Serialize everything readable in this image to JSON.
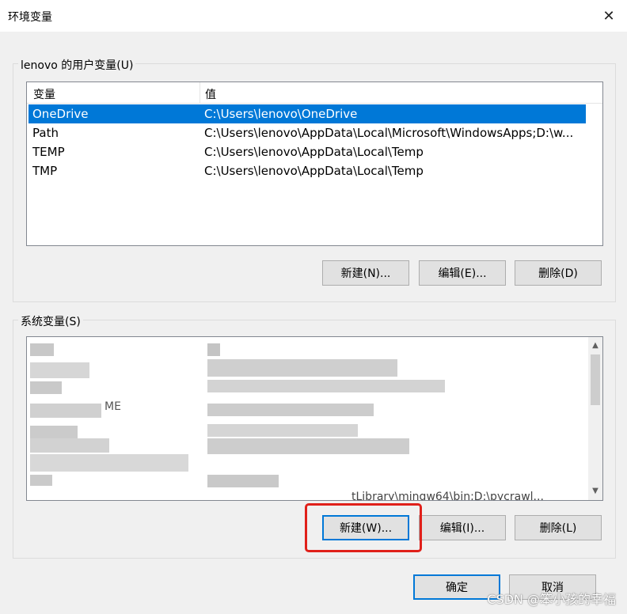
{
  "window": {
    "title": "环境变量",
    "close_symbol": "✕"
  },
  "user_vars": {
    "group_label": "lenovo 的用户变量(U)",
    "columns": [
      "变量",
      "值"
    ],
    "rows": [
      {
        "name": "OneDrive",
        "value": "C:\\Users\\lenovo\\OneDrive",
        "selected": true
      },
      {
        "name": "Path",
        "value": "C:\\Users\\lenovo\\AppData\\Local\\Microsoft\\WindowsApps;D:\\w...",
        "selected": false
      },
      {
        "name": "TEMP",
        "value": "C:\\Users\\lenovo\\AppData\\Local\\Temp",
        "selected": false
      },
      {
        "name": "TMP",
        "value": "C:\\Users\\lenovo\\AppData\\Local\\Temp",
        "selected": false
      }
    ],
    "buttons": {
      "new": "新建(N)...",
      "edit": "编辑(E)...",
      "delete": "删除(D)"
    }
  },
  "system_vars": {
    "group_label": "系统变量(S)",
    "partial_text_1": "ME",
    "partial_text_2": "tLibrary\\mingw64\\bin;D:\\pycrawl...",
    "buttons": {
      "new": "新建(W)...",
      "edit": "编辑(I)...",
      "delete": "删除(L)"
    }
  },
  "dialog_buttons": {
    "ok": "确定",
    "cancel": "取消"
  },
  "watermark": "CSDN @笨小孩的幸福",
  "colors": {
    "selection": "#0078d7",
    "highlight_box": "#e0201a"
  }
}
